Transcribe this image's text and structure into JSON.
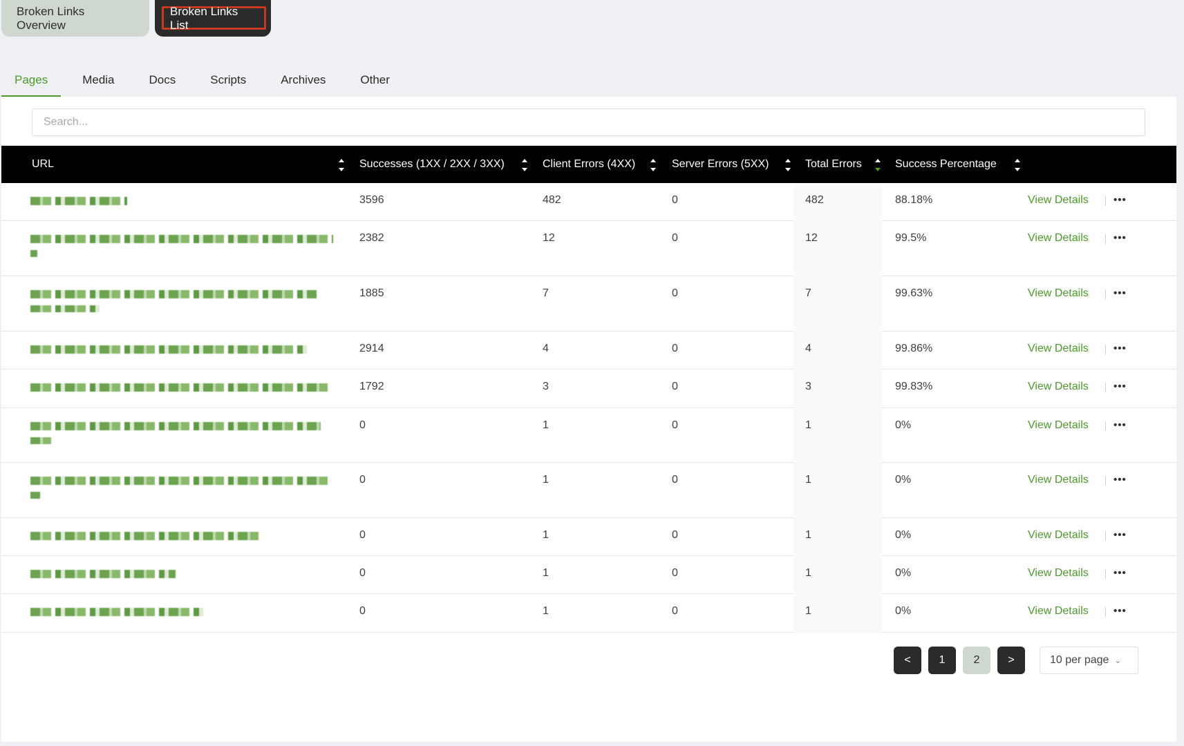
{
  "top_tabs": [
    {
      "label": "Broken Links Overview"
    },
    {
      "label": "Broken Links List"
    }
  ],
  "sub_tabs": [
    {
      "label": "Pages",
      "active": true
    },
    {
      "label": "Media"
    },
    {
      "label": "Docs"
    },
    {
      "label": "Scripts"
    },
    {
      "label": "Archives"
    },
    {
      "label": "Other"
    }
  ],
  "search": {
    "placeholder": "Search..."
  },
  "table": {
    "headers": {
      "url": "URL",
      "successes": "Successes (1XX / 2XX / 3XX)",
      "client_errors": "Client Errors (4XX)",
      "server_errors": "Server Errors (5XX)",
      "total_errors": "Total Errors",
      "success_pct": "Success Percentage"
    },
    "action_label": "View Details",
    "more_label": "•••",
    "rows": [
      {
        "successes": "3596",
        "client": "482",
        "server": "0",
        "total": "482",
        "pct": "88.18%"
      },
      {
        "successes": "2382",
        "client": "12",
        "server": "0",
        "total": "12",
        "pct": "99.5%"
      },
      {
        "successes": "1885",
        "client": "7",
        "server": "0",
        "total": "7",
        "pct": "99.63%"
      },
      {
        "successes": "2914",
        "client": "4",
        "server": "0",
        "total": "4",
        "pct": "99.86%"
      },
      {
        "successes": "1792",
        "client": "3",
        "server": "0",
        "total": "3",
        "pct": "99.83%"
      },
      {
        "successes": "0",
        "client": "1",
        "server": "0",
        "total": "1",
        "pct": "0%"
      },
      {
        "successes": "0",
        "client": "1",
        "server": "0",
        "total": "1",
        "pct": "0%"
      },
      {
        "successes": "0",
        "client": "1",
        "server": "0",
        "total": "1",
        "pct": "0%"
      },
      {
        "successes": "0",
        "client": "1",
        "server": "0",
        "total": "1",
        "pct": "0%"
      },
      {
        "successes": "0",
        "client": "1",
        "server": "0",
        "total": "1",
        "pct": "0%"
      }
    ]
  },
  "pagination": {
    "prev": "<",
    "pages": [
      "1",
      "2"
    ],
    "next": ">",
    "per_page": "10 per page"
  }
}
